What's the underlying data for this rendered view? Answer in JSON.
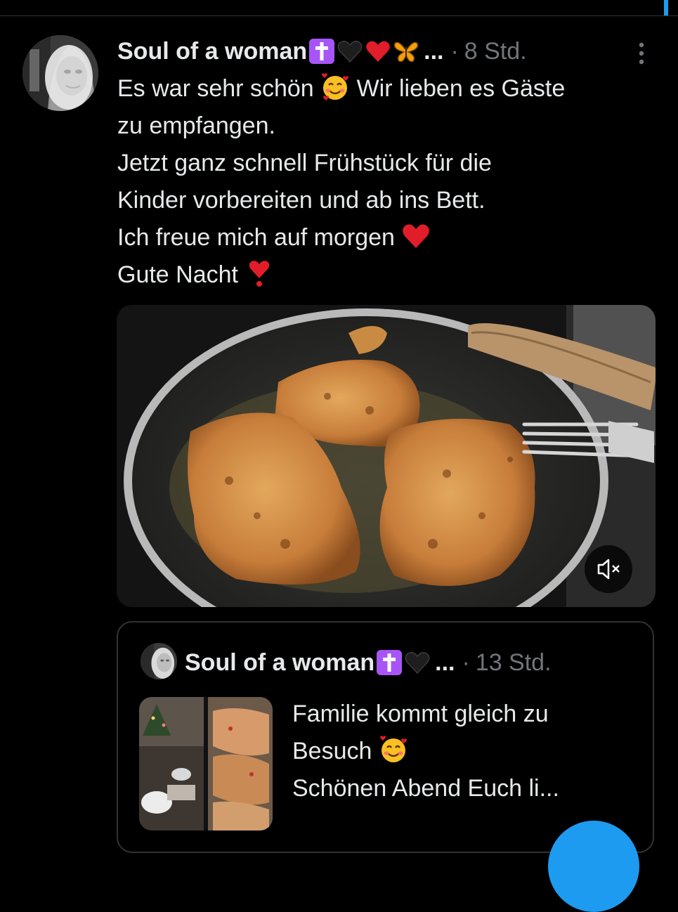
{
  "post": {
    "author_name": "Soul of a woman",
    "ellipsis": "...",
    "separator": "·",
    "time": "8 Std.",
    "lines": [
      "Es war sehr schön",
      "Wir lieben es Gäste",
      "zu empfangen.",
      "Jetzt ganz schnell Frühstück für die",
      "Kinder vorbereiten und ab ins Bett.",
      "Ich freue mich auf morgen",
      "Gute Nacht"
    ],
    "media": {
      "type": "video",
      "muted": true
    }
  },
  "quoted_post": {
    "author_name": "Soul of a woman",
    "ellipsis": "...",
    "separator": "·",
    "time": "13 Std.",
    "lines": [
      "Familie kommt gleich zu",
      "Besuch",
      "Schönen Abend Euch li..."
    ]
  },
  "icons": {
    "name_emojis": [
      "latin-cross-icon",
      "black-heart-icon",
      "red-heart-icon",
      "butterfly-icon"
    ],
    "quote_name_emojis": [
      "latin-cross-icon",
      "black-heart-icon"
    ],
    "more": "more-vertical-icon",
    "mute": "speaker-muted-icon"
  },
  "colors": {
    "background": "#000000",
    "text": "#e7e9ea",
    "muted_text": "#71767b",
    "border": "#2f3336",
    "accent": "#1d9bf0",
    "cross_purple": "#a855f7",
    "heart_red": "#e11d2a"
  }
}
